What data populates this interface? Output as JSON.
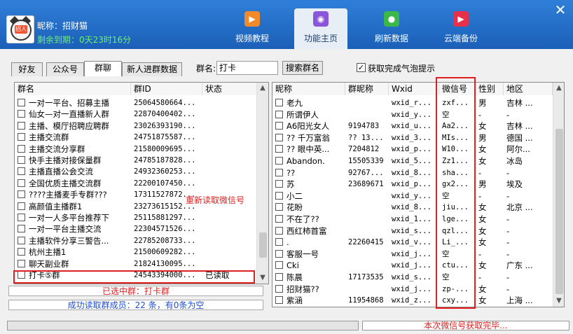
{
  "header": {
    "nickname": "昵称：招财猫",
    "remaining": "剩余到期：0天23时16分",
    "avatar_tag": "招人",
    "nav": [
      {
        "label": "视频教程",
        "icon": "video-icon",
        "color": "#f08a2a"
      },
      {
        "label": "功能主页",
        "icon": "home-icon",
        "color": "#8a55d8"
      },
      {
        "label": "刷新数据",
        "icon": "refresh-icon",
        "color": "#3cb84a"
      },
      {
        "label": "云端备份",
        "icon": "play-icon",
        "color": "#e8304a"
      }
    ],
    "close": "✕"
  },
  "tabs": [
    "好友",
    "公众号",
    "群聊",
    "新人进群数据"
  ],
  "active_tab": "群聊",
  "group_label": "群名:",
  "group_value": "打卡",
  "search_btn": "搜索群名",
  "bubble_checkbox": {
    "label": "获取完成气泡提示",
    "checked": "✓"
  },
  "left_table": {
    "columns": [
      "群名",
      "群ID",
      "状态"
    ],
    "rows": [
      {
        "name": "一对一平台、招募主播",
        "id": "25064580664...",
        "status": ""
      },
      {
        "name": "仙女—对一直播新人群",
        "id": "22870400402...",
        "status": ""
      },
      {
        "name": "主播、模厅招聘应聘群",
        "id": "23026393190...",
        "status": ""
      },
      {
        "name": "主播交流群",
        "id": "24751875587...",
        "status": ""
      },
      {
        "name": "主播交流分享群",
        "id": "21580009695...",
        "status": ""
      },
      {
        "name": "快手主播对接保量群",
        "id": "24785187828...",
        "status": ""
      },
      {
        "name": "主播直播公会交流",
        "id": "24932360253...",
        "status": ""
      },
      {
        "name": "全国优质主播交流群",
        "id": "22200107450...",
        "status": ""
      },
      {
        "name": "????主播麦手专群???",
        "id": "17311527872...",
        "status": ""
      },
      {
        "name": "高颜值主播群1",
        "id": "23273615152...",
        "status": ""
      },
      {
        "name": "一对一人多平台推荐下",
        "id": "25115881297...",
        "status": ""
      },
      {
        "name": "一对一平台主播交流",
        "id": "22304571526...",
        "status": ""
      },
      {
        "name": "主播软件分享三警告...",
        "id": "22785208733...",
        "status": ""
      },
      {
        "name": "杭州主播1",
        "id": "21500609282...",
        "status": ""
      },
      {
        "name": "聊天副业群",
        "id": "21824130095...",
        "status": ""
      },
      {
        "name": "打卡⑤群",
        "id": "24543394000...",
        "status": "已读取"
      }
    ]
  },
  "reread_hint": "重新读取微信号",
  "selected_group": "已选中群：打卡群",
  "success_msg": "成功读取群成员：22 条，有0条为空",
  "right_table": {
    "columns": [
      "昵称",
      "群昵称",
      "Wxid",
      "微信号",
      "性别",
      "地区"
    ],
    "rows": [
      {
        "nick": "老九",
        "gnick": "",
        "wxid": "wxid_r...",
        "wx": "zxf...",
        "sex": "男",
        "area": "吉林 ..."
      },
      {
        "nick": "所谓伊人",
        "gnick": "",
        "wxid": "wxid_y...",
        "wx": "空",
        "sex": "-",
        "area": "-"
      },
      {
        "nick": "A6阳光女人",
        "gnick": "9194783",
        "wxid": "wxid_u...",
        "wx": "Aa2...",
        "sex": "女",
        "area": "吉林 ..."
      },
      {
        "nick": "?? 千万富翁",
        "gnick": "?? 13...",
        "wxid": "wxid_3...",
        "wx": "MIs...",
        "sex": "男",
        "area": "德国 ..."
      },
      {
        "nick": "?? 眼中英...",
        "gnick": "7204812",
        "wxid": "wxid_p...",
        "wx": "W10...",
        "sex": "女",
        "area": "阿尔..."
      },
      {
        "nick": "Abandon.",
        "gnick": "15505339",
        "wxid": "wxid_5...",
        "wx": "Zz1...",
        "sex": "女",
        "area": "冰岛"
      },
      {
        "nick": "??",
        "gnick": "92767...",
        "wxid": "wxid_8...",
        "wx": "sha...",
        "sex": "-",
        "area": "-"
      },
      {
        "nick": "苏",
        "gnick": "23689671",
        "wxid": "wxid_p...",
        "wx": "gx2...",
        "sex": "男",
        "area": "埃及"
      },
      {
        "nick": "小二",
        "gnick": "",
        "wxid": "wxid_y...",
        "wx": "空",
        "sex": "-",
        "area": "-"
      },
      {
        "nick": "花盼",
        "gnick": "",
        "wxid": "wxid_8...",
        "wx": "jiu...",
        "sex": "女",
        "area": "北京 ..."
      },
      {
        "nick": "不在了??",
        "gnick": "",
        "wxid": "wxid_1...",
        "wx": "lge...",
        "sex": "女",
        "area": "-"
      },
      {
        "nick": "西红柿首富",
        "gnick": "",
        "wxid": "wxid_s...",
        "wx": "qzl...",
        "sex": "女",
        "area": "-"
      },
      {
        "nick": ".",
        "gnick": "22260415",
        "wxid": "wxid_v...",
        "wx": "Li_...",
        "sex": "女",
        "area": "-"
      },
      {
        "nick": "客服一号",
        "gnick": "",
        "wxid": "wxid_j...",
        "wx": "空",
        "sex": "-",
        "area": "-"
      },
      {
        "nick": "Cki",
        "gnick": "",
        "wxid": "wxid_j...",
        "wx": "ctu...",
        "sex": "女",
        "area": "广东 ..."
      },
      {
        "nick": "陈晨",
        "gnick": "17173535",
        "wxid": "wxid_s...",
        "wx": "空",
        "sex": "-",
        "area": "-"
      },
      {
        "nick": "招财猫??",
        "gnick": "",
        "wxid": "wxid_j...",
        "wx": "zp-...",
        "sex": "女",
        "area": "-"
      },
      {
        "nick": "紫涵",
        "gnick": "11954868",
        "wxid": "wxid_z...",
        "wx": "cxy...",
        "sex": "女",
        "area": "上海 ..."
      }
    ]
  },
  "status_done": "本次微信号获取完毕...",
  "colors": {
    "accent_red": "#e02020",
    "header_blue": "#1b5fb8",
    "link_blue": "#1c4fd8"
  }
}
